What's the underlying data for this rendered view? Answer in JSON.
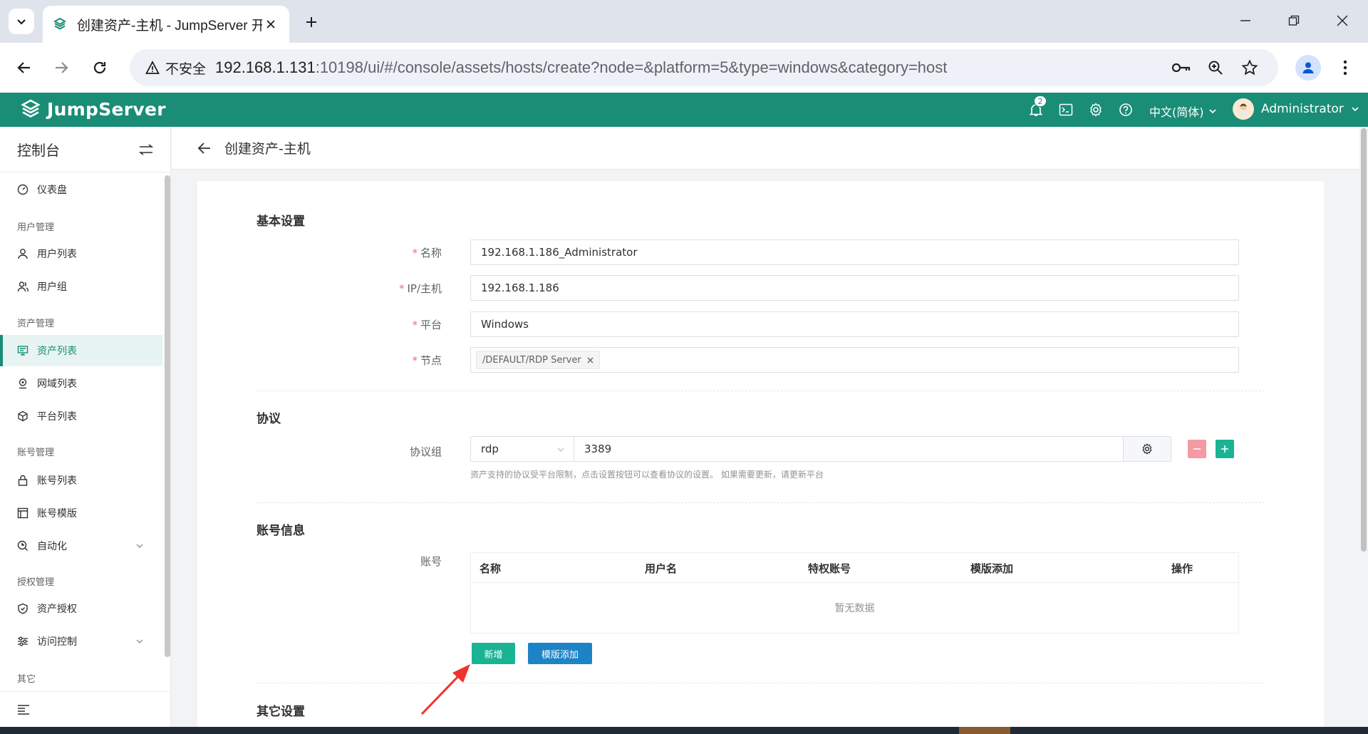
{
  "browser": {
    "tab_title": "创建资产-主机 - JumpServer 开",
    "security_label": "不安全",
    "url_host": "192.168.1.131",
    "url_rest": ":10198/ui/#/console/assets/hosts/create?node=&platform=5&type=windows&category=host"
  },
  "header": {
    "logo_text": "JumpServer",
    "notification_count": "2",
    "language": "中文(简体)",
    "user_name": "Administrator",
    "accent_color": "#1a8d76"
  },
  "sidebar": {
    "title": "控制台",
    "items": [
      {
        "type": "item",
        "label": "仪表盘",
        "icon": "dashboard-icon"
      },
      {
        "type": "group",
        "label": "用户管理"
      },
      {
        "type": "item",
        "label": "用户列表",
        "icon": "user-icon"
      },
      {
        "type": "item",
        "label": "用户组",
        "icon": "users-icon"
      },
      {
        "type": "group",
        "label": "资产管理"
      },
      {
        "type": "item",
        "label": "资产列表",
        "icon": "monitor-icon",
        "active": true
      },
      {
        "type": "item",
        "label": "网域列表",
        "icon": "location-icon"
      },
      {
        "type": "item",
        "label": "平台列表",
        "icon": "cube-icon"
      },
      {
        "type": "group",
        "label": "账号管理"
      },
      {
        "type": "item",
        "label": "账号列表",
        "icon": "lock-icon"
      },
      {
        "type": "item",
        "label": "账号模版",
        "icon": "template-icon"
      },
      {
        "type": "item",
        "label": "自动化",
        "icon": "automation-icon",
        "expandable": true
      },
      {
        "type": "group",
        "label": "授权管理"
      },
      {
        "type": "item",
        "label": "资产授权",
        "icon": "shield-icon"
      },
      {
        "type": "item",
        "label": "访问控制",
        "icon": "sliders-icon",
        "expandable": true
      },
      {
        "type": "group",
        "label": "其它"
      }
    ]
  },
  "page": {
    "title": "创建资产-主机"
  },
  "form": {
    "basic": {
      "title": "基本设置",
      "name_label": "名称",
      "name_value": "192.168.1.186_Administrator",
      "ip_label": "IP/主机",
      "ip_value": "192.168.1.186",
      "platform_label": "平台",
      "platform_value": "Windows",
      "node_label": "节点",
      "node_tag": "/DEFAULT/RDP Server"
    },
    "protocol": {
      "title": "协议",
      "group_label": "协议组",
      "protocol_value": "rdp",
      "port_value": "3389",
      "hint": "资产支持的协议受平台限制，点击设置按钮可以查看协议的设置。 如果需要更新，请更新平台"
    },
    "account": {
      "title": "账号信息",
      "label": "账号",
      "columns": [
        "名称",
        "用户名",
        "特权账号",
        "模版添加",
        "操作"
      ],
      "empty_text": "暂无数据",
      "add_button": "新增",
      "template_button": "模版添加"
    },
    "other": {
      "title": "其它设置"
    }
  }
}
